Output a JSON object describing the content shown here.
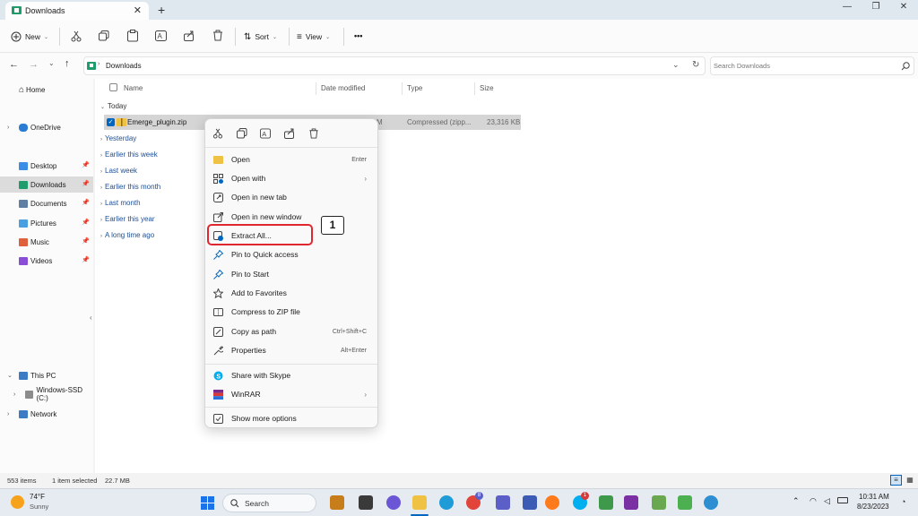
{
  "window": {
    "tab_title": "Downloads",
    "close_tab": "✕",
    "new_tab": "+",
    "minimize": "—",
    "restore": "❐",
    "close": "✕"
  },
  "toolbar": {
    "new_label": "New",
    "sort_label": "Sort",
    "view_label": "View",
    "more": "•••"
  },
  "address": {
    "path": "Downloads",
    "search_placeholder": "Search Downloads"
  },
  "sidebar": {
    "items": [
      {
        "label": "Home"
      },
      {
        "label": "OneDrive"
      },
      {
        "label": "Desktop"
      },
      {
        "label": "Downloads"
      },
      {
        "label": "Documents"
      },
      {
        "label": "Pictures"
      },
      {
        "label": "Music"
      },
      {
        "label": "Videos"
      },
      {
        "label": "This PC"
      },
      {
        "label": "Windows-SSD (C:)"
      },
      {
        "label": "Network"
      }
    ]
  },
  "columns": {
    "name": "Name",
    "date": "Date modified",
    "type": "Type",
    "size": "Size"
  },
  "groups": {
    "today": "Today",
    "yesterday": "Yesterday",
    "earlier_week": "Earlier this week",
    "last_week": "Last week",
    "earlier_month": "Earlier this month",
    "last_month": "Last month",
    "earlier_year": "Earlier this year",
    "long_ago": "A long time ago"
  },
  "file": {
    "name": "Emerge_plugin.zip",
    "date_partial": "M",
    "type": "Compressed (zipp...",
    "size": "23,316 KB"
  },
  "context_menu": {
    "open": "Open",
    "open_shortcut": "Enter",
    "open_with": "Open with",
    "open_new_tab": "Open in new tab",
    "open_new_window": "Open in new window",
    "extract_all": "Extract All...",
    "pin_quick": "Pin to Quick access",
    "pin_start": "Pin to Start",
    "favorites": "Add to Favorites",
    "compress": "Compress to ZIP file",
    "copy_path": "Copy as path",
    "copy_path_shortcut": "Ctrl+Shift+C",
    "properties": "Properties",
    "properties_shortcut": "Alt+Enter",
    "skype": "Share with Skype",
    "winrar": "WinRAR",
    "more_options": "Show more options"
  },
  "annotation": {
    "callout_number": "1"
  },
  "status": {
    "items": "553 items",
    "selected": "1 item selected",
    "size": "22.7 MB"
  },
  "taskbar": {
    "weather_temp": "74°F",
    "weather_desc": "Sunny",
    "search_label": "Search",
    "time": "10:31 AM",
    "date": "8/23/2023",
    "badge_chrome": "8",
    "badge_skype": "1"
  },
  "colors": {
    "accent": "#0067c0",
    "highlight_red": "#e0262e",
    "folder_yellow": "#f0c244",
    "selection": "#d5d5d5"
  }
}
